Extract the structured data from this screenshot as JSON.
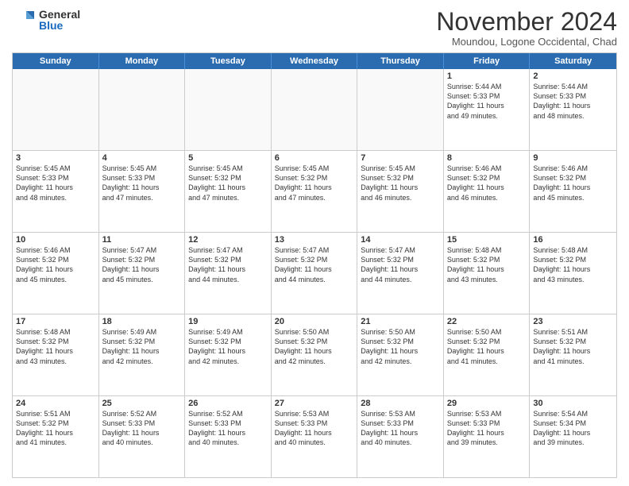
{
  "logo": {
    "general": "General",
    "blue": "Blue"
  },
  "title": "November 2024",
  "location": "Moundou, Logone Occidental, Chad",
  "header_days": [
    "Sunday",
    "Monday",
    "Tuesday",
    "Wednesday",
    "Thursday",
    "Friday",
    "Saturday"
  ],
  "weeks": [
    [
      {
        "day": "",
        "info": ""
      },
      {
        "day": "",
        "info": ""
      },
      {
        "day": "",
        "info": ""
      },
      {
        "day": "",
        "info": ""
      },
      {
        "day": "",
        "info": ""
      },
      {
        "day": "1",
        "info": "Sunrise: 5:44 AM\nSunset: 5:33 PM\nDaylight: 11 hours\nand 49 minutes."
      },
      {
        "day": "2",
        "info": "Sunrise: 5:44 AM\nSunset: 5:33 PM\nDaylight: 11 hours\nand 48 minutes."
      }
    ],
    [
      {
        "day": "3",
        "info": "Sunrise: 5:45 AM\nSunset: 5:33 PM\nDaylight: 11 hours\nand 48 minutes."
      },
      {
        "day": "4",
        "info": "Sunrise: 5:45 AM\nSunset: 5:33 PM\nDaylight: 11 hours\nand 47 minutes."
      },
      {
        "day": "5",
        "info": "Sunrise: 5:45 AM\nSunset: 5:32 PM\nDaylight: 11 hours\nand 47 minutes."
      },
      {
        "day": "6",
        "info": "Sunrise: 5:45 AM\nSunset: 5:32 PM\nDaylight: 11 hours\nand 47 minutes."
      },
      {
        "day": "7",
        "info": "Sunrise: 5:45 AM\nSunset: 5:32 PM\nDaylight: 11 hours\nand 46 minutes."
      },
      {
        "day": "8",
        "info": "Sunrise: 5:46 AM\nSunset: 5:32 PM\nDaylight: 11 hours\nand 46 minutes."
      },
      {
        "day": "9",
        "info": "Sunrise: 5:46 AM\nSunset: 5:32 PM\nDaylight: 11 hours\nand 45 minutes."
      }
    ],
    [
      {
        "day": "10",
        "info": "Sunrise: 5:46 AM\nSunset: 5:32 PM\nDaylight: 11 hours\nand 45 minutes."
      },
      {
        "day": "11",
        "info": "Sunrise: 5:47 AM\nSunset: 5:32 PM\nDaylight: 11 hours\nand 45 minutes."
      },
      {
        "day": "12",
        "info": "Sunrise: 5:47 AM\nSunset: 5:32 PM\nDaylight: 11 hours\nand 44 minutes."
      },
      {
        "day": "13",
        "info": "Sunrise: 5:47 AM\nSunset: 5:32 PM\nDaylight: 11 hours\nand 44 minutes."
      },
      {
        "day": "14",
        "info": "Sunrise: 5:47 AM\nSunset: 5:32 PM\nDaylight: 11 hours\nand 44 minutes."
      },
      {
        "day": "15",
        "info": "Sunrise: 5:48 AM\nSunset: 5:32 PM\nDaylight: 11 hours\nand 43 minutes."
      },
      {
        "day": "16",
        "info": "Sunrise: 5:48 AM\nSunset: 5:32 PM\nDaylight: 11 hours\nand 43 minutes."
      }
    ],
    [
      {
        "day": "17",
        "info": "Sunrise: 5:48 AM\nSunset: 5:32 PM\nDaylight: 11 hours\nand 43 minutes."
      },
      {
        "day": "18",
        "info": "Sunrise: 5:49 AM\nSunset: 5:32 PM\nDaylight: 11 hours\nand 42 minutes."
      },
      {
        "day": "19",
        "info": "Sunrise: 5:49 AM\nSunset: 5:32 PM\nDaylight: 11 hours\nand 42 minutes."
      },
      {
        "day": "20",
        "info": "Sunrise: 5:50 AM\nSunset: 5:32 PM\nDaylight: 11 hours\nand 42 minutes."
      },
      {
        "day": "21",
        "info": "Sunrise: 5:50 AM\nSunset: 5:32 PM\nDaylight: 11 hours\nand 42 minutes."
      },
      {
        "day": "22",
        "info": "Sunrise: 5:50 AM\nSunset: 5:32 PM\nDaylight: 11 hours\nand 41 minutes."
      },
      {
        "day": "23",
        "info": "Sunrise: 5:51 AM\nSunset: 5:32 PM\nDaylight: 11 hours\nand 41 minutes."
      }
    ],
    [
      {
        "day": "24",
        "info": "Sunrise: 5:51 AM\nSunset: 5:32 PM\nDaylight: 11 hours\nand 41 minutes."
      },
      {
        "day": "25",
        "info": "Sunrise: 5:52 AM\nSunset: 5:33 PM\nDaylight: 11 hours\nand 40 minutes."
      },
      {
        "day": "26",
        "info": "Sunrise: 5:52 AM\nSunset: 5:33 PM\nDaylight: 11 hours\nand 40 minutes."
      },
      {
        "day": "27",
        "info": "Sunrise: 5:53 AM\nSunset: 5:33 PM\nDaylight: 11 hours\nand 40 minutes."
      },
      {
        "day": "28",
        "info": "Sunrise: 5:53 AM\nSunset: 5:33 PM\nDaylight: 11 hours\nand 40 minutes."
      },
      {
        "day": "29",
        "info": "Sunrise: 5:53 AM\nSunset: 5:33 PM\nDaylight: 11 hours\nand 39 minutes."
      },
      {
        "day": "30",
        "info": "Sunrise: 5:54 AM\nSunset: 5:34 PM\nDaylight: 11 hours\nand 39 minutes."
      }
    ]
  ]
}
